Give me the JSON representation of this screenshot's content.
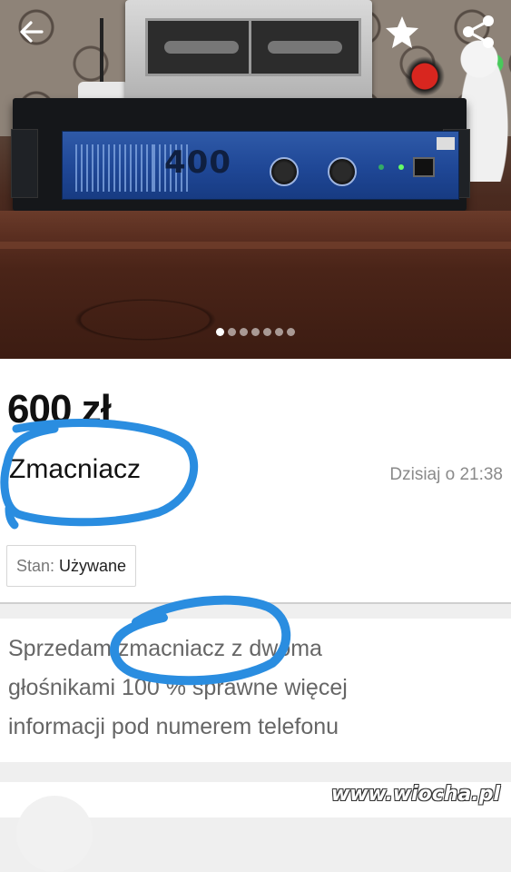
{
  "photo": {
    "amplifier_model": "400",
    "carousel": {
      "count": 7,
      "active_index": 0
    }
  },
  "topbar": {
    "back_icon": "arrow-left-icon",
    "favorite_icon": "star-icon",
    "share_icon": "share-icon"
  },
  "listing": {
    "price": "600 zł",
    "title": "Zmacniacz",
    "posted": "Dzisiaj o 21:38",
    "condition_label": "Stan:",
    "condition_value": "Używane"
  },
  "description": {
    "line1": "Sprzedam zmacniacz z dwoma",
    "line2": "głośnikami 100 % sprawne  więcej",
    "line3": "informacji pod numerem telefonu"
  },
  "watermark": "www.wiocha.pl",
  "colors": {
    "annotation_blue": "#2a8de0",
    "icon_white": "#ffffff",
    "amp_blue": "#1f4796"
  }
}
